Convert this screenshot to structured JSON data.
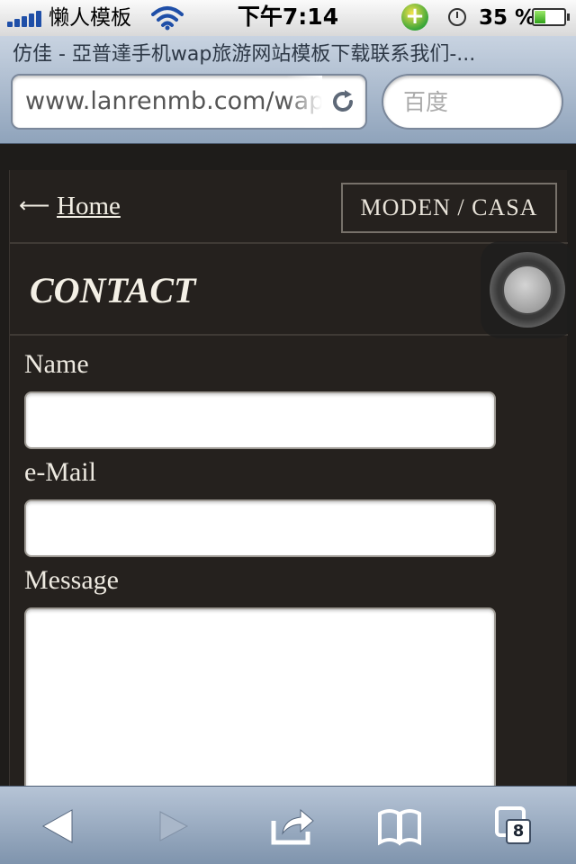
{
  "status_bar": {
    "carrier": "懒人模板",
    "time": "下午7:14",
    "battery_percent_label": "35 %",
    "battery_level": 0.35,
    "icons": [
      "signal-icon",
      "wifi-icon",
      "sync-icon",
      "clock-icon",
      "battery-icon"
    ]
  },
  "browser": {
    "page_title": "仿佳 - 亞普達手机wap旅游网站模板下载联系我们-...",
    "url": "www.lanrenmb.com/wap",
    "search_placeholder": "百度"
  },
  "site": {
    "back_link": "Home",
    "logo": "MODEN / CASA",
    "heading": "CONTACT",
    "form": {
      "name_label": "Name",
      "name_value": "",
      "email_label": "e-Mail",
      "email_value": "",
      "message_label": "Message",
      "message_value": ""
    }
  },
  "toolbar": {
    "tab_count": "8",
    "icons": [
      "back-icon",
      "forward-icon",
      "share-icon",
      "bookmarks-icon",
      "tabs-icon"
    ]
  },
  "colors": {
    "page_background": "#25211e",
    "text_light": "#f4f0e6",
    "chrome_blue": "#8fa3bb",
    "ios_blue": "#1f4fa8"
  }
}
